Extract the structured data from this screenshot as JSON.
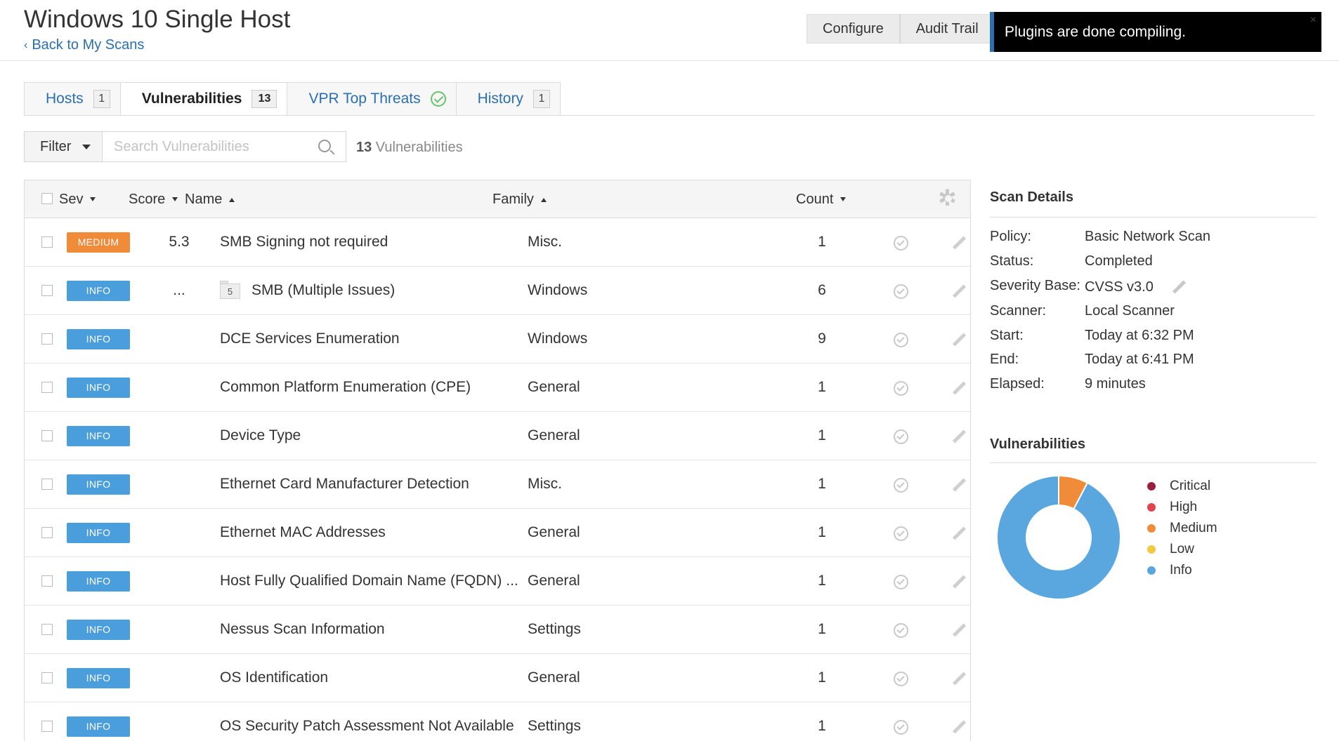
{
  "header": {
    "title": "Windows 10 Single Host",
    "back_label": "Back to My Scans",
    "configure_label": "Configure",
    "audit_trail_label": "Audit Trail"
  },
  "toast": {
    "message": "Plugins are done compiling.",
    "close_glyph": "×"
  },
  "tabs": [
    {
      "label": "Hosts",
      "badge": "1"
    },
    {
      "label": "Vulnerabilities",
      "badge": "13",
      "active": true
    },
    {
      "label": "VPR Top Threats",
      "icon": "check-circle-icon"
    },
    {
      "label": "History",
      "badge": "1"
    }
  ],
  "filter": {
    "label": "Filter",
    "search_placeholder": "Search Vulnerabilities",
    "count_number": "13",
    "count_suffix": " Vulnerabilities"
  },
  "table": {
    "columns": {
      "sev": "Sev",
      "score": "Score",
      "name": "Name",
      "family": "Family",
      "count": "Count"
    },
    "rows": [
      {
        "sev": "MEDIUM",
        "sev_class": "medium",
        "score": "5.3",
        "name": "SMB Signing not required",
        "family": "Misc.",
        "count": "1"
      },
      {
        "sev": "INFO",
        "sev_class": "info",
        "score": "...",
        "folder_count": "5",
        "name": "SMB (Multiple Issues)",
        "family": "Windows",
        "count": "6"
      },
      {
        "sev": "INFO",
        "sev_class": "info",
        "score": "",
        "name": "DCE Services Enumeration",
        "family": "Windows",
        "count": "9"
      },
      {
        "sev": "INFO",
        "sev_class": "info",
        "score": "",
        "name": "Common Platform Enumeration (CPE)",
        "family": "General",
        "count": "1"
      },
      {
        "sev": "INFO",
        "sev_class": "info",
        "score": "",
        "name": "Device Type",
        "family": "General",
        "count": "1"
      },
      {
        "sev": "INFO",
        "sev_class": "info",
        "score": "",
        "name": "Ethernet Card Manufacturer Detection",
        "family": "Misc.",
        "count": "1"
      },
      {
        "sev": "INFO",
        "sev_class": "info",
        "score": "",
        "name": "Ethernet MAC Addresses",
        "family": "General",
        "count": "1"
      },
      {
        "sev": "INFO",
        "sev_class": "info",
        "score": "",
        "name": "Host Fully Qualified Domain Name (FQDN) ...",
        "family": "General",
        "count": "1"
      },
      {
        "sev": "INFO",
        "sev_class": "info",
        "score": "",
        "name": "Nessus Scan Information",
        "family": "Settings",
        "count": "1"
      },
      {
        "sev": "INFO",
        "sev_class": "info",
        "score": "",
        "name": "OS Identification",
        "family": "General",
        "count": "1"
      },
      {
        "sev": "INFO",
        "sev_class": "info",
        "score": "",
        "name": "OS Security Patch Assessment Not Available",
        "family": "Settings",
        "count": "1"
      }
    ]
  },
  "scan_details": {
    "title": "Scan Details",
    "fields": [
      {
        "label": "Policy:",
        "value": "Basic Network Scan"
      },
      {
        "label": "Status:",
        "value": "Completed"
      },
      {
        "label": "Severity Base:",
        "value": "CVSS v3.0"
      },
      {
        "label": "Scanner:",
        "value": "Local Scanner"
      },
      {
        "label": "Start:",
        "value": "Today at 6:32 PM"
      },
      {
        "label": "End:",
        "value": "Today at 6:41 PM"
      },
      {
        "label": "Elapsed:",
        "value": "9 minutes"
      }
    ]
  },
  "vuln_summary": {
    "title": "Vulnerabilities",
    "legend": [
      {
        "label": "Critical",
        "color": "#9b1d3d"
      },
      {
        "label": "High",
        "color": "#e0454f"
      },
      {
        "label": "Medium",
        "color": "#f08b3a"
      },
      {
        "label": "Low",
        "color": "#f5c842"
      },
      {
        "label": "Info",
        "color": "#5aa7e0"
      }
    ]
  },
  "chart_data": {
    "type": "pie",
    "categories": [
      "Critical",
      "High",
      "Medium",
      "Low",
      "Info"
    ],
    "values": [
      0,
      0,
      1,
      0,
      12
    ],
    "colors": [
      "#9b1d3d",
      "#e0454f",
      "#f08b3a",
      "#f5c842",
      "#5aa7e0"
    ],
    "title": "Vulnerabilities",
    "legend_position": "right"
  }
}
